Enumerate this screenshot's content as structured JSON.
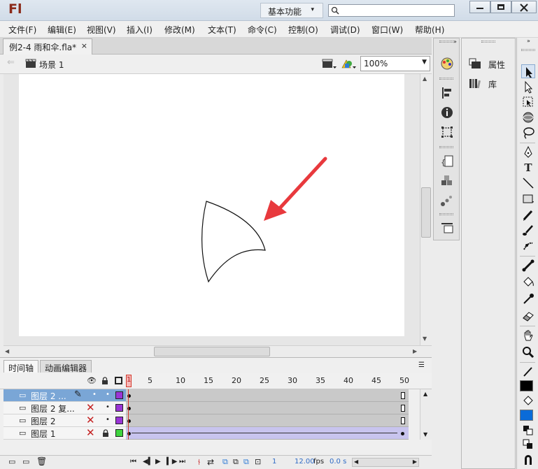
{
  "app": {
    "logo": "Fl",
    "workspace": "基本功能",
    "search_placeholder": ""
  },
  "menu": [
    "文件(F)",
    "编辑(E)",
    "视图(V)",
    "插入(I)",
    "修改(M)",
    "文本(T)",
    "命令(C)",
    "控制(O)",
    "调试(D)",
    "窗口(W)",
    "帮助(H)"
  ],
  "document": {
    "tab_title": "例2-4 雨和伞.fla*",
    "close": "×",
    "scene": "场景 1",
    "zoom": "100%"
  },
  "panels": {
    "properties": "属性",
    "library": "库"
  },
  "timeline": {
    "tabs": [
      "时间轴",
      "动画编辑器"
    ],
    "frame_numbers": [
      "1",
      "5",
      "10",
      "15",
      "20",
      "25",
      "30",
      "35",
      "40",
      "45",
      "50"
    ],
    "layers": [
      {
        "name": "图层 2 ...",
        "selected": true
      },
      {
        "name": "图层 2 复...",
        "selected": false
      },
      {
        "name": "图层 2",
        "selected": false
      },
      {
        "name": "图层 1",
        "selected": false
      }
    ],
    "current_frame": "1",
    "fps": "12.00",
    "fps_unit": "fps",
    "time": "0.0 s"
  },
  "colors": {
    "accent": "#d33a2c",
    "stroke_swatch": "#000000",
    "fill_swatch": "#0a6bd8",
    "selected_layer": "#7aa6d6"
  }
}
